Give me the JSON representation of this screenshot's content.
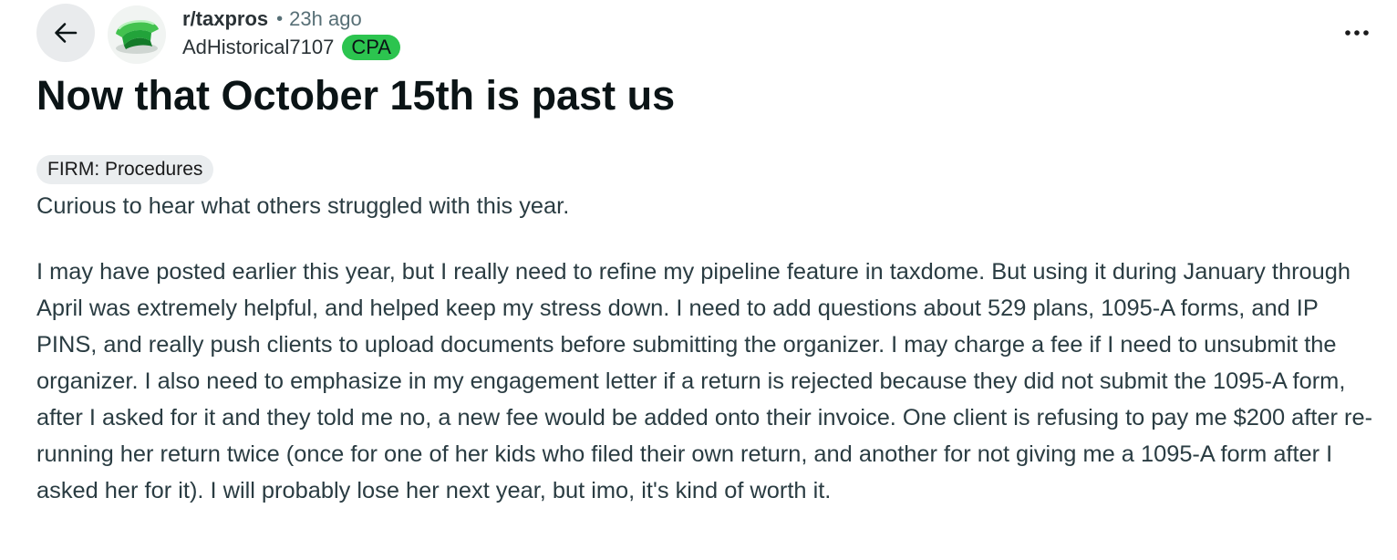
{
  "header": {
    "back_icon": "arrow-left-icon",
    "avatar_icon": "green-visor-icon",
    "subreddit": "r/taxpros",
    "separator": "•",
    "time_ago": "23h ago",
    "author": "AdHistorical7107",
    "author_flair": "CPA",
    "author_flair_color": "#2cc44f",
    "overflow_icon": "more-horizontal-icon"
  },
  "post": {
    "title": "Now that October 15th is past us",
    "post_flair": "FIRM: Procedures",
    "paragraphs": [
      "Curious to hear what others struggled with this year.",
      "I may have posted earlier this year, but I really need to refine my pipeline feature in taxdome. But using it during January through April was extremely helpful, and helped keep my stress down. I need to add questions about 529 plans, 1095-A forms, and IP PINS, and really push clients to upload documents before submitting the organizer. I may charge a fee if I need to unsubmit the organizer. I also need to emphasize in my engagement letter if a return is rejected because they did not submit the 1095-A form, after I asked for it and they told me no, a new fee would be added onto their invoice. One client is refusing to pay me $200 after re-running her return twice (once for one of her kids who filed their own return, and another for not giving me a 1095-A form after I asked her for it). I will probably lose her next year, but imo, it's kind of worth it."
    ]
  }
}
